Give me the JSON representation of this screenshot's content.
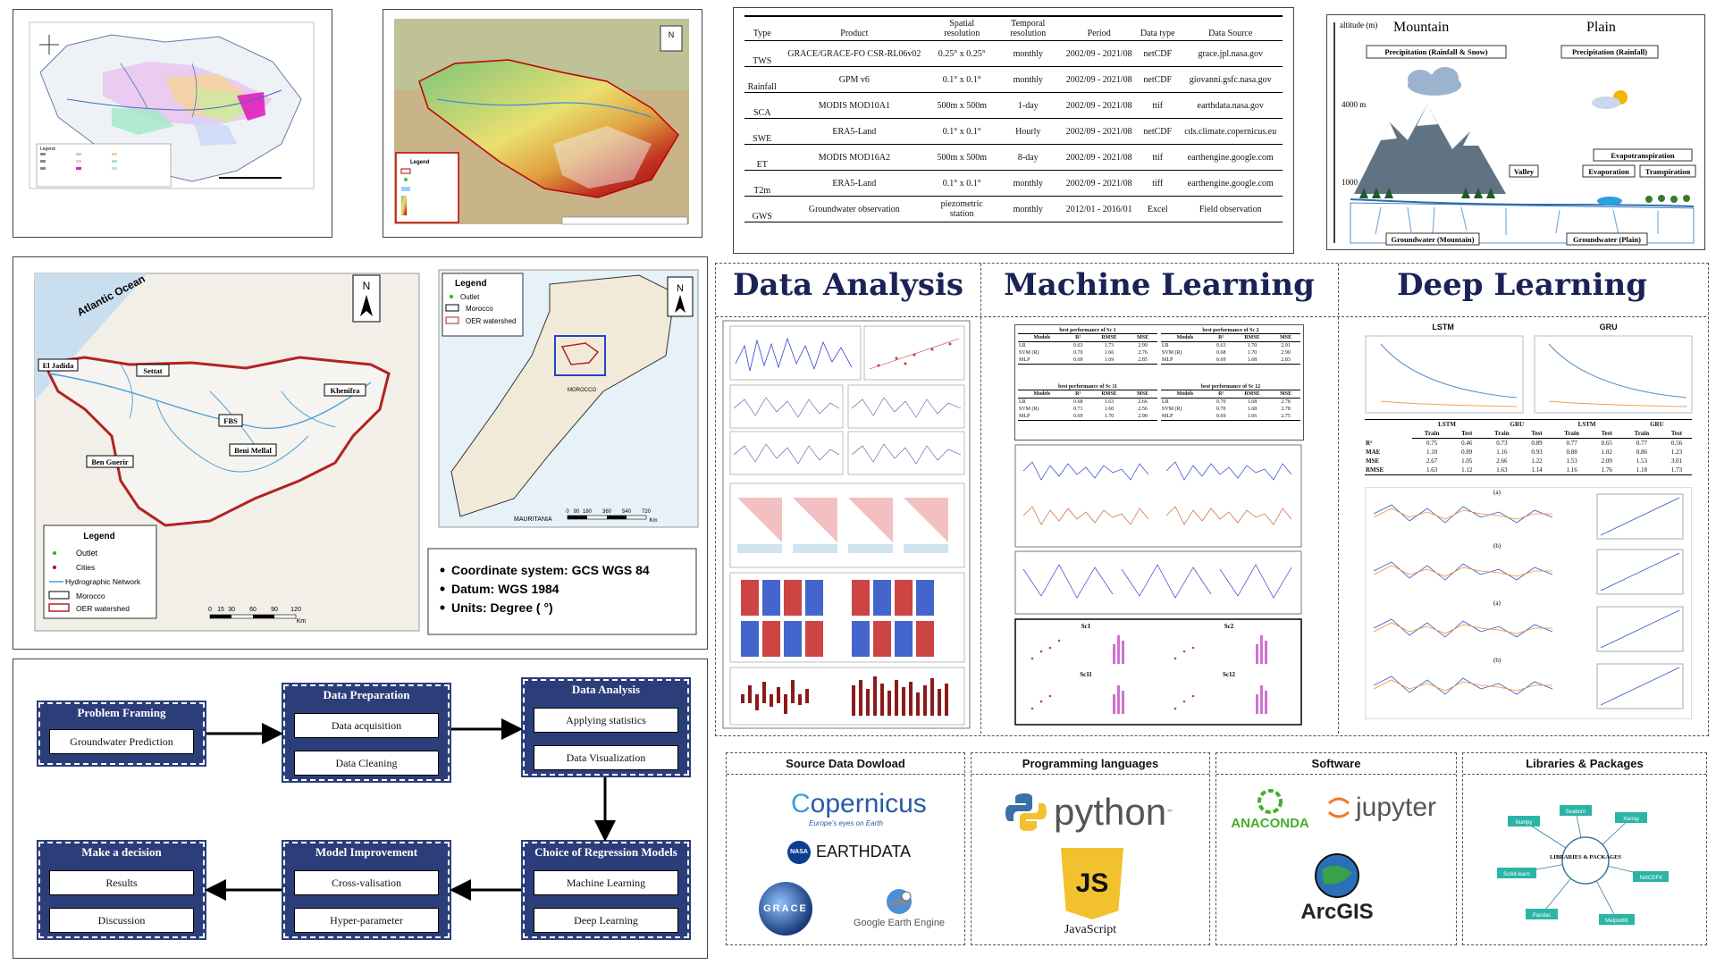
{
  "maps": {
    "legend_title": "Legend",
    "detail_map": {
      "ocean_label": "Atlantic Ocean",
      "cities": [
        "El Jadida",
        "Settat",
        "Khenifra",
        "FBS",
        "Beni Mellal",
        "Ben Guerir"
      ],
      "legend": {
        "title": "Legend",
        "items": [
          "Outlet",
          "Cities",
          "Hydrographic Network",
          "Morocco",
          "OER watershed"
        ]
      },
      "scale_ticks": [
        "0",
        "15",
        "30",
        "60",
        "90",
        "120"
      ],
      "scale_unit": "Km"
    },
    "inset_map": {
      "legend": {
        "title": "Legend",
        "items": [
          "Outlet",
          "Morocco",
          "OER watershed"
        ]
      },
      "scale_ticks": [
        "0",
        "90",
        "180",
        "360",
        "540",
        "720"
      ],
      "scale_unit": "Km",
      "country_label": "MAURITANIA",
      "city_label": "MOROCCO"
    },
    "info_lines": [
      "Coordinate system: GCS WGS 84",
      "Datum: WGS 1984",
      "Units: Degree ( °)"
    ]
  },
  "data_table": {
    "headers": [
      "Type",
      "Product",
      "Spatial resolution",
      "Temporal resolution",
      "Period",
      "Data type",
      "Data Source"
    ],
    "rows": [
      [
        "TWS",
        "GRACE/GRACE-FO CSR-RL06v02",
        "0.25° x 0.25°",
        "monthly",
        "2002/09 - 2021/08",
        "netCDF",
        "grace.jpl.nasa.gov"
      ],
      [
        "Rainfall",
        "GPM v6",
        "0.1° x 0.1°",
        "monthly",
        "2002/09 - 2021/08",
        "netCDF",
        "giovanni.gsfc.nasa.gov"
      ],
      [
        "SCA",
        "MODIS MOD10A1",
        "500m x 500m",
        "1-day",
        "2002/09 - 2021/08",
        "ttif",
        "earthdata.nasa.gov"
      ],
      [
        "SWE",
        "ERA5-Land",
        "0.1° x 0.1°",
        "Hourly",
        "2002/09 - 2021/08",
        "netCDF",
        "cds.climate.copernicus.eu"
      ],
      [
        "ET",
        "MODIS MOD16A2",
        "500m x 500m",
        "8-day",
        "2002/09 - 2021/08",
        "ttif",
        "earthengine.google.com"
      ],
      [
        "T2m",
        "ERA5-Land",
        "0.1° x 0.1°",
        "monthly",
        "2002/09 - 2021/08",
        "tiff",
        "earthengine.google.com"
      ],
      [
        "GWS",
        "Groundwater observation",
        "piezometric station",
        "monthly",
        "2012/01 - 2016/01",
        "Excel",
        "Field observation"
      ]
    ]
  },
  "hydro_diagram": {
    "altitude_label": "altitude (m)",
    "mountain": "Mountain",
    "plain": "Plain",
    "precip_mountain": "Precipitation (Rainfall & Snow)",
    "precip_plain": "Precipitation (Rainfall)",
    "alt_4000": "4000 m",
    "alt_1000": "1000 m",
    "valley": "Valley",
    "evapotranspiration": "Evapotranspiration",
    "evaporation": "Evaporation",
    "transpiration": "Transpiration",
    "gw_mountain": "Groundwater (Mountain)",
    "gw_plain": "Groundwater (Plain)"
  },
  "sections": {
    "data_analysis": "Data Analysis",
    "machine_learning": "Machine Learning",
    "deep_learning": "Deep Learning",
    "lstm": "LSTM",
    "gru": "GRU",
    "sub_a": "(a)",
    "sub_b": "(b)"
  },
  "ml_tables": {
    "titles": [
      "best performance of Sc 1",
      "best performance of Sc 2",
      "best performance of Sc 11",
      "best performance of Sc 12"
    ],
    "header": [
      "Models",
      "R²",
      "RMSE",
      "MSE"
    ],
    "rows": [
      [
        [
          "LR",
          "0.63",
          "1.73",
          "2.99"
        ],
        [
          "SVM (R)",
          "0.70",
          "1.66",
          "2.76"
        ],
        [
          "MLP",
          "0.69",
          "1.69",
          "2.85"
        ]
      ],
      [
        [
          "LR",
          "0.63",
          "1.70",
          "2.91"
        ],
        [
          "SVM (R)",
          "0.68",
          "1.70",
          "2.90"
        ],
        [
          "MLP",
          "0.69",
          "1.68",
          "2.83"
        ]
      ],
      [
        [
          "LR",
          "0.68",
          "1.63",
          "2.66"
        ],
        [
          "SVM (R)",
          "0.71",
          "1.60",
          "2.56"
        ],
        [
          "MLP",
          "0.69",
          "1.70",
          "2.90"
        ]
      ],
      [
        [
          "LR",
          "0.70",
          "1.68",
          "2.78"
        ],
        [
          "SVM (R)",
          "0.70",
          "1.68",
          "2.78"
        ],
        [
          "MLP",
          "0.69",
          "1.66",
          "2.75"
        ]
      ]
    ],
    "scenario_labels": [
      "Sc1",
      "Sc2",
      "Sc11",
      "Sc12"
    ]
  },
  "dl_table": {
    "groups": [
      "LSTM",
      "GRU",
      "LSTM",
      "GRU"
    ],
    "sub": [
      "Train",
      "Test"
    ],
    "rows": [
      [
        "R²",
        "0.75",
        "0.46",
        "0.73",
        "0.89",
        "0.77",
        "0.65",
        "0.77",
        "0.56"
      ],
      [
        "MAE",
        "1.10",
        "0.89",
        "1.16",
        "0.93",
        "0.88",
        "1.02",
        "0.86",
        "1.23"
      ],
      [
        "MSE",
        "2.67",
        "1.05",
        "2.66",
        "1.22",
        "1.53",
        "2.09",
        "1.53",
        "3.01"
      ],
      [
        "RMSE",
        "1.63",
        "1.12",
        "1.63",
        "1.14",
        "1.16",
        "1.76",
        "1.18",
        "1.73"
      ]
    ]
  },
  "flowchart": {
    "problem_framing": {
      "title": "Problem Framing",
      "items": [
        "Groundwater Prediction"
      ]
    },
    "data_preparation": {
      "title": "Data Preparation",
      "items": [
        "Data acquisition",
        "Data Cleaning"
      ]
    },
    "data_analysis": {
      "title": "Data Analysis",
      "items": [
        "Applying statistics",
        "Data Visualization"
      ]
    },
    "choice_models": {
      "title": "Choice of Regression Models",
      "items": [
        "Machine Learning",
        "Deep Learning"
      ]
    },
    "model_improvement": {
      "title": "Model Improvement",
      "items": [
        "Cross-valisation",
        "Hyper-parameter"
      ]
    },
    "make_decision": {
      "title": "Make a decision",
      "items": [
        "Results",
        "Discussion"
      ]
    }
  },
  "tools": {
    "source": {
      "title": "Source Data Dowload",
      "copernicus": "opernicus",
      "copernicus_sub": "Europe's eyes on Earth",
      "nasa": "NASA",
      "earthdata": "EARTHDATA",
      "grace": "GRACE",
      "gee": "Google Earth Engine"
    },
    "languages": {
      "title": "Programming languages",
      "python": "python",
      "tm": "™",
      "js": "JS",
      "javascript": "JavaScript"
    },
    "software": {
      "title": "Software",
      "anaconda": "ANACONDA",
      "jupyter": "jupyter",
      "arcgis": "ArcGIS"
    },
    "libraries": {
      "title": "Libraries & Packages",
      "center": "LIBRARIES & PACKAGES",
      "items": [
        "Numpy",
        "Seaborn",
        "Xarray",
        "Scikit-learn",
        "NetCDF4",
        "Pandas",
        "Matplotlib"
      ]
    }
  },
  "colors": {
    "navy": "#2c3e7a",
    "title_navy": "#1b2356",
    "watershed_red": "#b22222",
    "river_blue": "#4a9fd6"
  }
}
